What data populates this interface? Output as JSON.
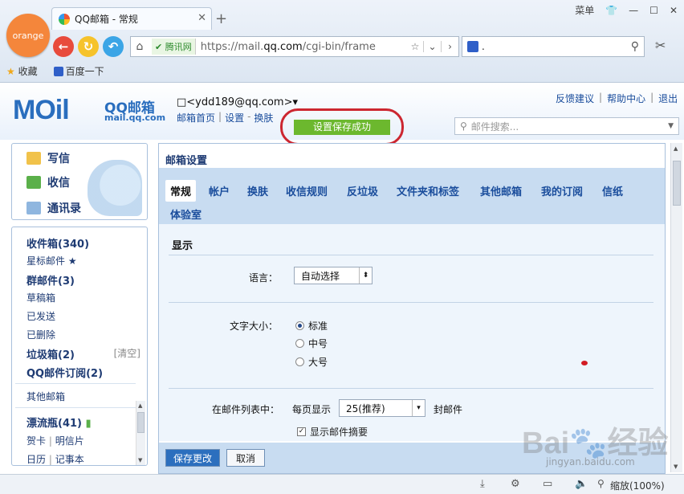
{
  "browser": {
    "badge": "orange",
    "tab_title": "QQ邮箱 - 常规",
    "tab_close": "✕",
    "new_tab": "+",
    "window_controls": {
      "menu": "菜单",
      "skin": "👕",
      "min": "—",
      "max": "☐",
      "close": "✕"
    },
    "url_security": "腾讯网",
    "url_prefix": "https://mail.",
    "url_domain": "qq.com",
    "url_suffix": "/cgi-bin/frame",
    "search_placeholder": ".",
    "bookmarks": [
      "收藏",
      "百度一下"
    ]
  },
  "mail_header": {
    "logo_text": "MOil",
    "brand": "QQ邮箱",
    "brand_url": "mail.qq.com",
    "account": "□<ydd189@qq.com>▾",
    "nav": [
      "邮箱首页",
      "设置",
      "换肤"
    ],
    "success_message": "设置保存成功",
    "right_links": [
      "反馈建议",
      "帮助中心",
      "退出"
    ],
    "search_placeholder": "邮件搜索..."
  },
  "sidebar": {
    "actions": [
      "写信",
      "收信",
      "通讯录"
    ],
    "folders": [
      {
        "label": "收件箱(340)",
        "bold": true
      },
      {
        "label": "星标邮件 ★",
        "bold": false
      },
      {
        "label": "群邮件(3)",
        "bold": true
      },
      {
        "label": "草稿箱",
        "bold": false
      },
      {
        "label": "已发送",
        "bold": false
      },
      {
        "label": "已删除",
        "bold": false
      },
      {
        "label": "垃圾箱(2)",
        "bold": true
      },
      {
        "label": "QQ邮件订阅(2)",
        "bold": true
      }
    ],
    "clear_label": "[清空]",
    "other_mailbox": "其他邮箱",
    "drift_bottle": "漂流瓶(41)",
    "apps_row1": [
      "贺卡",
      "明信片"
    ],
    "apps_row2": [
      "日历",
      "记事本"
    ]
  },
  "settings": {
    "title": "邮箱设置",
    "tabs": [
      "常规",
      "帐户",
      "换肤",
      "收信规则",
      "反垃圾",
      "文件夹和标签",
      "其他邮箱",
      "我的订阅",
      "信纸",
      "体验室"
    ],
    "active_tab": "常规",
    "section_title": "显示",
    "language_label": "语言：",
    "language_value": "自动选择",
    "fontsize_label": "文字大小：",
    "fontsize_options": [
      "标准",
      "中号",
      "大号"
    ],
    "fontsize_selected": "标准",
    "list_label": "在邮件列表中：",
    "per_page_label": "每页显示",
    "per_page_value": "25(推荐)",
    "per_page_unit": "封邮件",
    "show_summary": "显示邮件摘要",
    "show_summary_checked": true,
    "save_button": "保存更改",
    "cancel_button": "取消"
  },
  "status": {
    "zoom": "缩放(100%)"
  },
  "watermark": {
    "text": "Bai🐾经验",
    "sub": "jingyan.baidu.com"
  }
}
